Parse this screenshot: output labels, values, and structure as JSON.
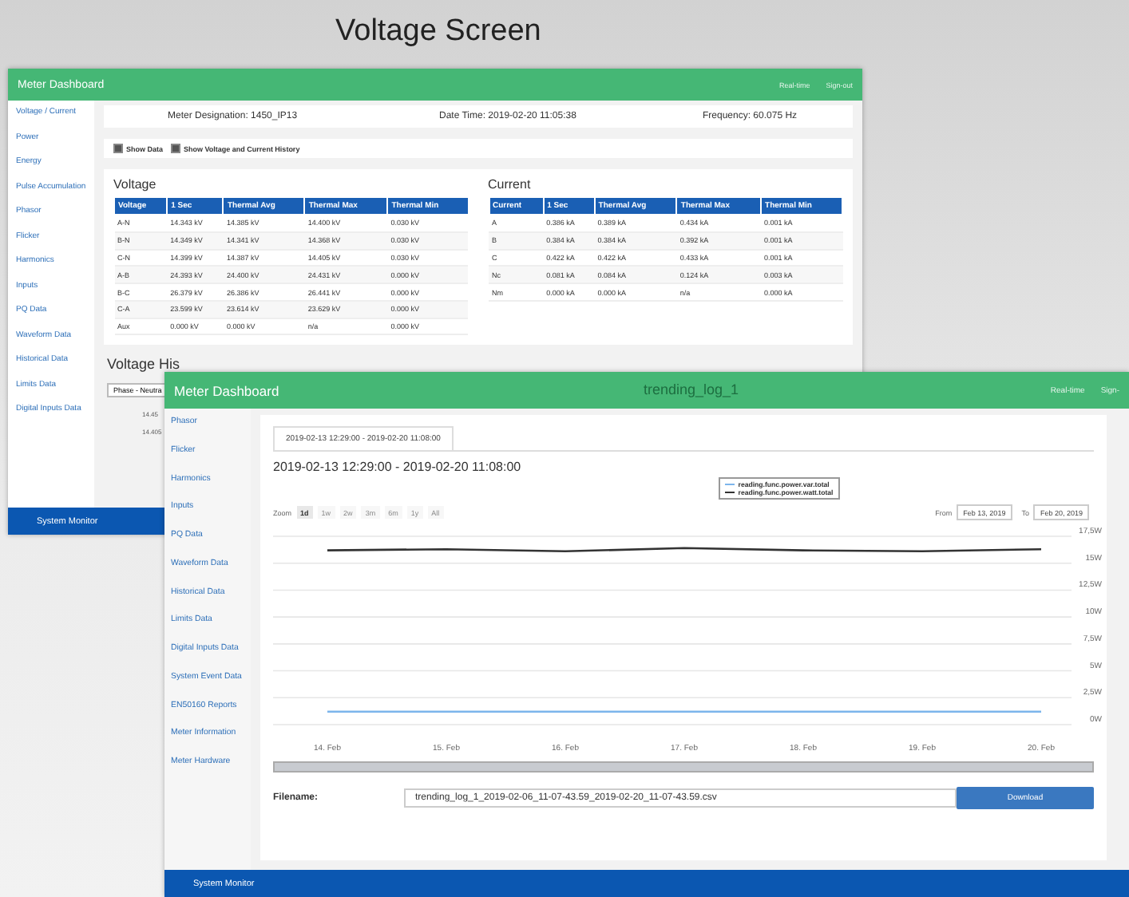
{
  "caption": "Voltage Screen",
  "back_window": {
    "title": "Meter Dashboard",
    "nav_links": [
      "Real-time",
      "Sign-out"
    ],
    "sidebar": {
      "items": [
        "Voltage / Current",
        "Power",
        "Energy",
        "Pulse Accumulation",
        "Phasor",
        "Flicker",
        "Harmonics",
        "Inputs",
        "PQ Data",
        "Waveform Data",
        "Historical Data",
        "Limits Data",
        "Digital Inputs Data"
      ]
    },
    "info": {
      "designation": "Meter Designation: 1450_IP13",
      "date_time": "Date Time: 2019-02-20 11:05:38",
      "frequency": "Frequency: 60.075 Hz"
    },
    "checkboxes": [
      {
        "label": "Show Data",
        "checked": true
      },
      {
        "label": "Show Voltage and Current History",
        "checked": true
      }
    ],
    "tables": [
      {
        "title": "Voltage",
        "columns": [
          "Voltage",
          "1 Sec",
          "Thermal Avg",
          "Thermal Max",
          "Thermal Min"
        ],
        "rows": [
          [
            "A-N",
            "14.343 kV",
            "14.385 kV",
            "14.400 kV",
            "0.030 kV"
          ],
          [
            "B-N",
            "14.349 kV",
            "14.341 kV",
            "14.368 kV",
            "0.030 kV"
          ],
          [
            "C-N",
            "14.399 kV",
            "14.387 kV",
            "14.405 kV",
            "0.030 kV"
          ],
          [
            "A-B",
            "24.393 kV",
            "24.400 kV",
            "24.431 kV",
            "0.000 kV"
          ],
          [
            "B-C",
            "26.379 kV",
            "26.386 kV",
            "26.441 kV",
            "0.000 kV"
          ],
          [
            "C-A",
            "23.599 kV",
            "23.614 kV",
            "23.629 kV",
            "0.000 kV"
          ],
          [
            "Aux",
            "0.000 kV",
            "0.000 kV",
            "n/a",
            "0.000 kV"
          ]
        ]
      },
      {
        "title": "Current",
        "columns": [
          "Current",
          "1 Sec",
          "Thermal Avg",
          "Thermal Max",
          "Thermal Min"
        ],
        "rows": [
          [
            "A",
            "0.386 kA",
            "0.389 kA",
            "0.434 kA",
            "0.001 kA"
          ],
          [
            "B",
            "0.384 kA",
            "0.384 kA",
            "0.392 kA",
            "0.001 kA"
          ],
          [
            "C",
            "0.422 kA",
            "0.422 kA",
            "0.433 kA",
            "0.001 kA"
          ],
          [
            "Nc",
            "0.081 kA",
            "0.084 kA",
            "0.124 kA",
            "0.003 kA"
          ],
          [
            "Nm",
            "0.000 kA",
            "0.000 kA",
            "n/a",
            "0.000 kA"
          ]
        ]
      }
    ],
    "history": {
      "title": "Voltage His",
      "select": "Phase - Neutra",
      "axis_labels": [
        "14.45",
        "14.405"
      ]
    },
    "footer": "System Monitor"
  },
  "front_window": {
    "title": "Meter Dashboard",
    "ghost_title": "trending_log_1",
    "nav_links": [
      "Real-time",
      "Sign-"
    ],
    "sidebar": {
      "items": [
        "Phasor",
        "Flicker",
        "Harmonics",
        "Inputs",
        "PQ Data",
        "Waveform Data",
        "Historical Data",
        "Limits Data",
        "Digital Inputs Data",
        "System Event Data",
        "EN50160 Reports",
        "Meter Information",
        "Meter Hardware"
      ]
    },
    "tab": "2019-02-13 12:29:00 - 2019-02-20 11:08:00",
    "heading": "2019-02-13 12:29:00 - 2019-02-20 11:08:00",
    "zoom": {
      "label": "Zoom",
      "options": [
        {
          "label": "1d",
          "selected": true
        },
        {
          "label": "1w",
          "selected": false
        },
        {
          "label": "2w",
          "selected": false
        },
        {
          "label": "3m",
          "selected": false
        },
        {
          "label": "6m",
          "selected": false
        },
        {
          "label": "1y",
          "selected": false
        },
        {
          "label": "All",
          "selected": false
        }
      ]
    },
    "range": {
      "from_label": "From",
      "from": "Feb 13, 2019",
      "to_label": "To",
      "to": "Feb 20, 2019"
    },
    "chart_data": {
      "type": "line",
      "grid": true,
      "categories": [
        "14. Feb",
        "15. Feb",
        "16. Feb",
        "17. Feb",
        "18. Feb",
        "19. Feb",
        "20. Feb"
      ],
      "ylim": [
        0,
        17.5
      ],
      "yticks": [
        {
          "value": 0,
          "label": "0W"
        },
        {
          "value": 2.5,
          "label": "2,5W"
        },
        {
          "value": 5,
          "label": "5W"
        },
        {
          "value": 7.5,
          "label": "7,5W"
        },
        {
          "value": 10,
          "label": "10W"
        },
        {
          "value": 12.5,
          "label": "12,5W"
        },
        {
          "value": 15,
          "label": "15W"
        },
        {
          "value": 17.5,
          "label": "17,5W"
        }
      ],
      "series": [
        {
          "name": "reading.func.power.var.total",
          "color": "#7cb5ec",
          "values": [
            1.2,
            1.2,
            1.2,
            1.2,
            1.2,
            1.2,
            1.2
          ]
        },
        {
          "name": "reading.func.power.watt.total",
          "color": "#333333",
          "values": [
            16.2,
            16.3,
            16.1,
            16.4,
            16.2,
            16.1,
            16.3
          ]
        }
      ]
    },
    "filename_label": "Filename:",
    "filename": "trending_log_1_2019-02-06_11-07-43.59_2019-02-20_11-07-43.59.csv",
    "download": "Download",
    "footer": "System Monitor"
  }
}
